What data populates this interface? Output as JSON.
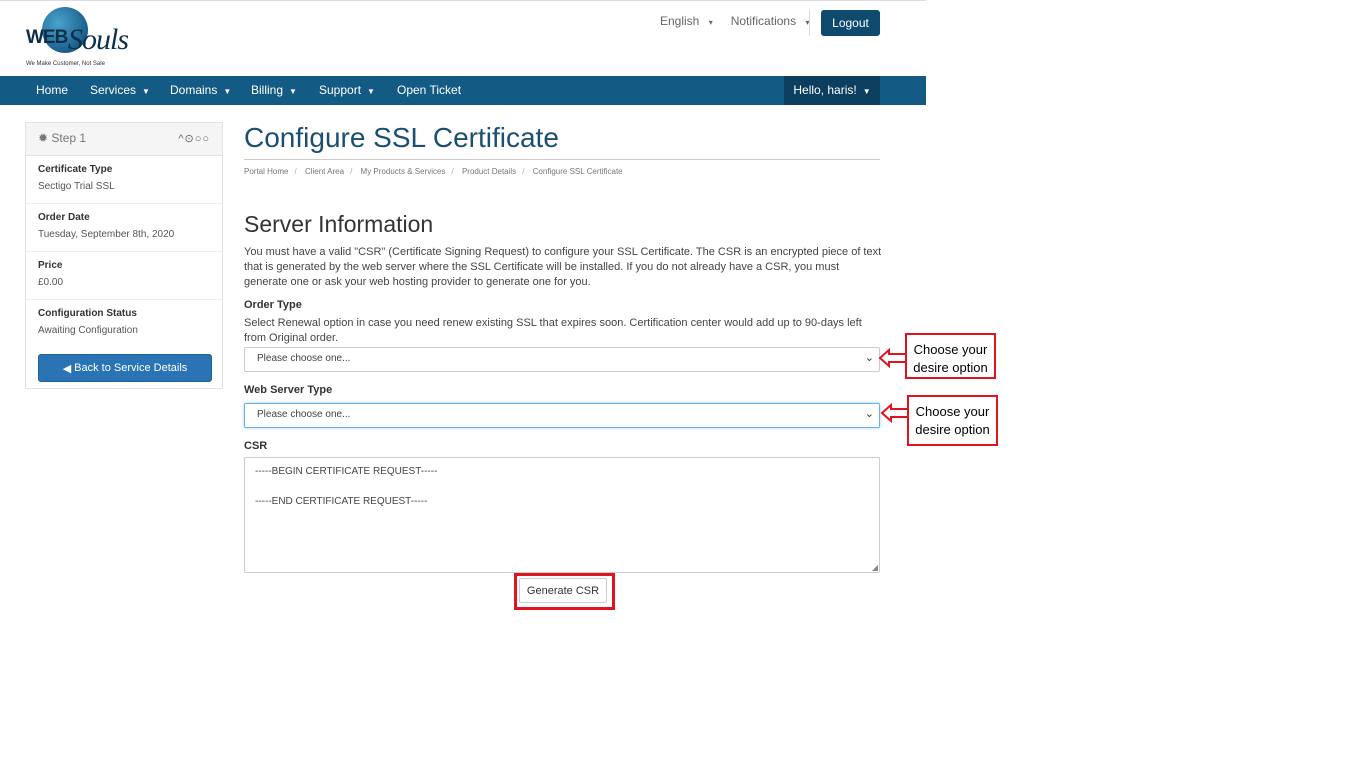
{
  "header": {
    "logo": {
      "brand_web": "WEB",
      "brand_souls": "Souls",
      "tagline": "We Make Customer, Not Sale"
    },
    "language_label": "English",
    "notifications_label": "Notifications",
    "logout_label": "Logout"
  },
  "nav": {
    "items": [
      {
        "label": "Home"
      },
      {
        "label": "Services"
      },
      {
        "label": "Domains"
      },
      {
        "label": "Billing"
      },
      {
        "label": "Support"
      },
      {
        "label": "Open Ticket"
      }
    ],
    "user_greeting": "Hello, haris!"
  },
  "sidebar": {
    "step_label": "Step 1",
    "step_indicator": "^⊙○○",
    "fields": [
      {
        "label": "Certificate Type",
        "value": "Sectigo Trial SSL"
      },
      {
        "label": "Order Date",
        "value": "Tuesday, September 8th, 2020"
      },
      {
        "label": "Price",
        "value": "£0.00"
      },
      {
        "label": "Configuration Status",
        "value": "Awaiting Configuration"
      }
    ],
    "back_button_label": "Back to Service Details"
  },
  "main": {
    "title": "Configure SSL Certificate",
    "breadcrumb": [
      "Portal Home",
      "Client Area",
      "My Products & Services",
      "Product Details",
      "Configure SSL Certificate"
    ],
    "section_title": "Server Information",
    "description": "You must have a valid \"CSR\" (Certificate Signing Request) to configure your SSL Certificate. The CSR is an encrypted piece of text that is generated by the web server where the SSL Certificate will be installed. If you do not already have a CSR, you must generate one or ask your web hosting provider to generate one for you.",
    "order_type": {
      "label": "Order Type",
      "help": "Select Renewal option in case you need renew existing SSL that expires soon. Certification center would add up to 90-days left from Original order.",
      "selected": "Please choose one..."
    },
    "web_server_type": {
      "label": "Web Server Type",
      "selected": "Please choose one..."
    },
    "csr": {
      "label": "CSR",
      "line1": "-----BEGIN CERTIFICATE REQUEST-----",
      "line2": "-----END CERTIFICATE REQUEST-----"
    },
    "generate_button_label": "Generate CSR"
  },
  "annotations": {
    "callout_1": "Choose your desire option",
    "callout_2": "Choose your desire option"
  },
  "colors": {
    "nav": "#135a84",
    "nav_dark": "#0c3f5f",
    "title": "#1b4f72",
    "button": "#2a73b5",
    "annotation": "#e0141e"
  }
}
